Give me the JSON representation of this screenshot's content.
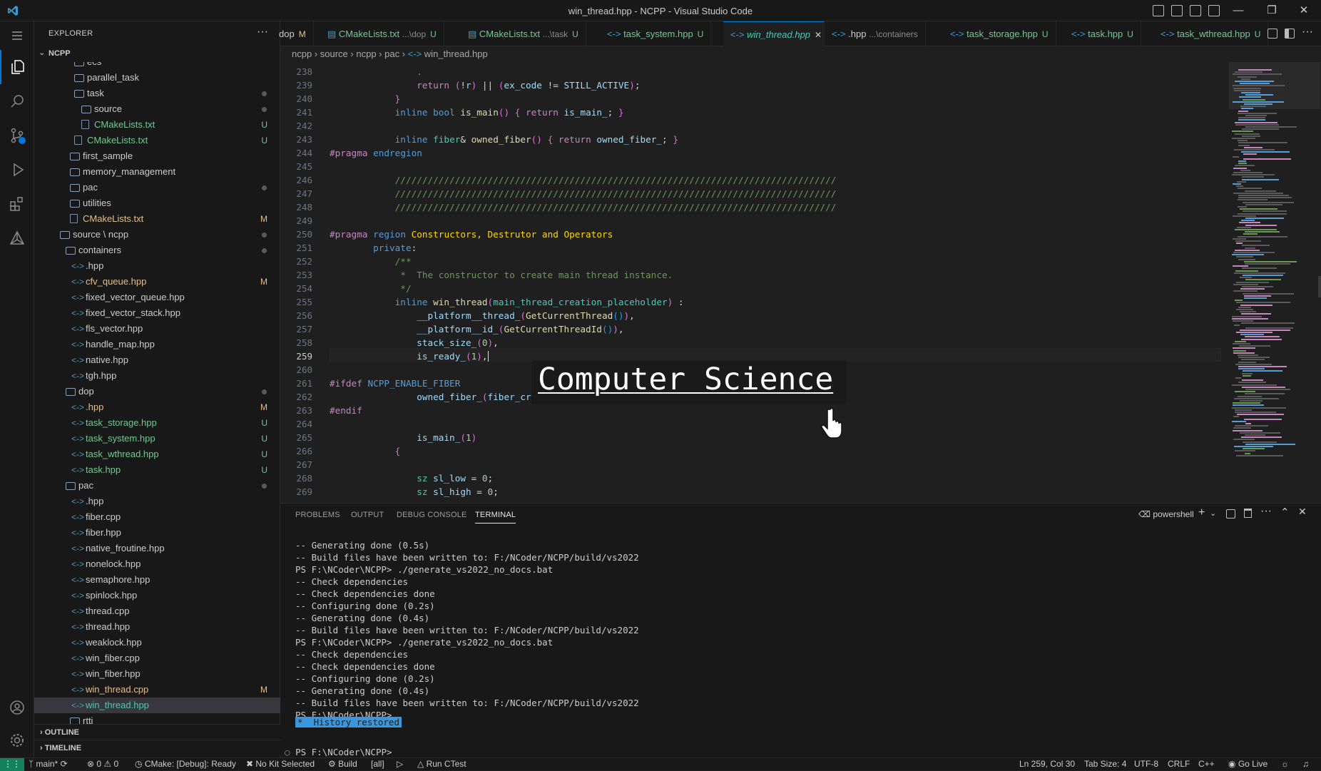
{
  "window": {
    "title": "win_thread.hpp - NCPP - Visual Studio Code"
  },
  "colors": {
    "accent": "#0078d4",
    "statusbar_remote": "#16825d",
    "untracked": "#73c991",
    "modified": "#e2c08d"
  },
  "sidebar": {
    "header": "EXPLORER",
    "more": "···",
    "root": "NCPP",
    "items": [
      {
        "label": "ecs",
        "type": "folder",
        "status": ""
      },
      {
        "label": "parallel_task",
        "type": "folder",
        "status": ""
      },
      {
        "label": "task",
        "type": "folder",
        "status": "•"
      },
      {
        "label": "source",
        "type": "folder",
        "status": "•"
      },
      {
        "label": "CMakeLists.txt",
        "type": "file",
        "status": "U"
      },
      {
        "label": "CMakeLists.txt",
        "type": "file",
        "status": "U"
      },
      {
        "label": "first_sample",
        "type": "folder",
        "status": ""
      },
      {
        "label": "memory_management",
        "type": "folder",
        "status": ""
      },
      {
        "label": "pac",
        "type": "folder",
        "status": "•"
      },
      {
        "label": "utilities",
        "type": "folder",
        "status": ""
      },
      {
        "label": "CMakeLists.txt",
        "type": "file",
        "status": "M"
      },
      {
        "label": "source \\ ncpp",
        "type": "folder",
        "status": "•"
      },
      {
        "label": "containers",
        "type": "folder",
        "status": "•"
      },
      {
        "label": ".hpp",
        "type": "hpp",
        "status": ""
      },
      {
        "label": "cfv_queue.hpp",
        "type": "hpp",
        "status": "M"
      },
      {
        "label": "fixed_vector_queue.hpp",
        "type": "hpp",
        "status": ""
      },
      {
        "label": "fixed_vector_stack.hpp",
        "type": "hpp",
        "status": ""
      },
      {
        "label": "fls_vector.hpp",
        "type": "hpp",
        "status": ""
      },
      {
        "label": "handle_map.hpp",
        "type": "hpp",
        "status": ""
      },
      {
        "label": "native.hpp",
        "type": "hpp",
        "status": ""
      },
      {
        "label": "tgh.hpp",
        "type": "hpp",
        "status": ""
      },
      {
        "label": "dop",
        "type": "folder",
        "status": "•"
      },
      {
        "label": ".hpp",
        "type": "hpp",
        "status": "M"
      },
      {
        "label": "task_storage.hpp",
        "type": "hpp",
        "status": "U"
      },
      {
        "label": "task_system.hpp",
        "type": "hpp",
        "status": "U"
      },
      {
        "label": "task_wthread.hpp",
        "type": "hpp",
        "status": "U"
      },
      {
        "label": "task.hpp",
        "type": "hpp",
        "status": "U"
      },
      {
        "label": "pac",
        "type": "folder",
        "status": "•"
      },
      {
        "label": ".hpp",
        "type": "hpp",
        "status": ""
      },
      {
        "label": "fiber.cpp",
        "type": "hpp",
        "status": ""
      },
      {
        "label": "fiber.hpp",
        "type": "hpp",
        "status": ""
      },
      {
        "label": "native_froutine.hpp",
        "type": "hpp",
        "status": ""
      },
      {
        "label": "nonelock.hpp",
        "type": "hpp",
        "status": ""
      },
      {
        "label": "semaphore.hpp",
        "type": "hpp",
        "status": ""
      },
      {
        "label": "spinlock.hpp",
        "type": "hpp",
        "status": ""
      },
      {
        "label": "thread.cpp",
        "type": "hpp",
        "status": ""
      },
      {
        "label": "thread.hpp",
        "type": "hpp",
        "status": ""
      },
      {
        "label": "weaklock.hpp",
        "type": "hpp",
        "status": ""
      },
      {
        "label": "win_fiber.cpp",
        "type": "hpp",
        "status": ""
      },
      {
        "label": "win_fiber.hpp",
        "type": "hpp",
        "status": ""
      },
      {
        "label": "win_thread.cpp",
        "type": "hpp",
        "status": "M"
      },
      {
        "label": "win_thread.hpp",
        "type": "hpp",
        "status": ""
      },
      {
        "label": "rtti",
        "type": "folder",
        "status": ""
      }
    ],
    "outline": "OUTLINE",
    "timeline": "TIMELINE"
  },
  "tabs": [
    {
      "name": "dop",
      "path": "",
      "mark": "M"
    },
    {
      "name": "CMakeLists.txt",
      "path": "...\\dop",
      "mark": "U"
    },
    {
      "name": "CMakeLists.txt",
      "path": "...\\task",
      "mark": "U"
    },
    {
      "name": "task_system.hpp",
      "path": "",
      "mark": "U"
    },
    {
      "name": "win_thread.hpp",
      "path": "",
      "mark": "✕"
    },
    {
      "name": ".hpp",
      "path": "...\\containers",
      "mark": ""
    },
    {
      "name": "task_storage.hpp",
      "path": "",
      "mark": "U"
    },
    {
      "name": "task.hpp",
      "path": "",
      "mark": "U"
    },
    {
      "name": "task_wthread.hpp",
      "path": "",
      "mark": "U"
    }
  ],
  "breadcrumb": [
    "ncpp",
    "source",
    "ncpp",
    "pac",
    "win_thread.hpp"
  ],
  "editor": {
    "line_numbers": [
      "238",
      "239",
      "240",
      "241",
      "242",
      "243",
      "244",
      "245",
      "246",
      "247",
      "248",
      "249",
      "250",
      "251",
      "252",
      "253",
      "254",
      "255",
      "256",
      "257",
      "258",
      "259",
      "260",
      "261",
      "262",
      "263",
      "264",
      "265",
      "266",
      "267",
      "268",
      "269"
    ],
    "current_line": "259"
  },
  "panel": {
    "tabs": [
      "PROBLEMS",
      "OUTPUT",
      "DEBUG CONSOLE",
      "TERMINAL"
    ],
    "shell": "powershell",
    "terminal": [
      "-- Generating done (0.5s)",
      "-- Build files have been written to: F:/NCoder/NCPP/build/vs2022",
      "PS F:\\NCoder\\NCPP> ./generate_vs2022_no_docs.bat",
      "-- Check dependencies",
      "-- Check dependencies done",
      "-- Configuring done (0.2s)",
      "-- Generating done (0.4s)",
      "-- Build files have been written to: F:/NCoder/NCPP/build/vs2022",
      "PS F:\\NCoder\\NCPP> ./generate_vs2022_no_docs.bat",
      "-- Check dependencies",
      "-- Check dependencies done",
      "-- Configuring done (0.2s)",
      "-- Generating done (0.4s)",
      "-- Build files have been written to: F:/NCoder/NCPP/build/vs2022",
      "PS F:\\NCoder\\NCPP>"
    ],
    "history": "History restored",
    "prompt": "PS F:\\NCoder\\NCPP>"
  },
  "statusbar": {
    "branch": "main*",
    "problems": "⊗ 0 ⚠ 0",
    "cmake": "CMake: [Debug]: Ready",
    "kit": "No Kit Selected",
    "build": "Build",
    "target": "[all]",
    "ctest": "Run CTest",
    "position": "Ln 259, Col 30",
    "tabsize": "Tab Size: 4",
    "encoding": "UTF-8",
    "eol": "CRLF",
    "language": "C++",
    "golive": "Go Live"
  },
  "overlay": {
    "text": "Computer Science"
  }
}
